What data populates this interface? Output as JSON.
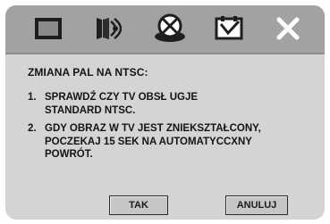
{
  "tabs": [
    {
      "icon": "screen-icon"
    },
    {
      "icon": "speaker-icon"
    },
    {
      "icon": "disc-icon"
    },
    {
      "icon": "preferences-icon"
    },
    {
      "icon": "close-icon"
    }
  ],
  "dialog": {
    "heading": "ZMIANA PAL NA NTSC:",
    "steps": [
      {
        "number": "1.",
        "lines": [
          "SPRAWDŹ CZY TV OBSŁ UGJE",
          "STANDARD NTSC."
        ]
      },
      {
        "number": "2.",
        "lines": [
          "GDY OBRAZ W TV JEST ZNIEKSZTAŁCONY,",
          "POCZEKAJ 15 SEK NA AUTOMATYCCXNY",
          "POWRÓT."
        ]
      }
    ],
    "ok_label": "TAK",
    "cancel_label": "ANULUJ"
  },
  "colors": {
    "panel": "#d4d4d4",
    "topbar": "#a2a2a2",
    "text": "#141414"
  }
}
